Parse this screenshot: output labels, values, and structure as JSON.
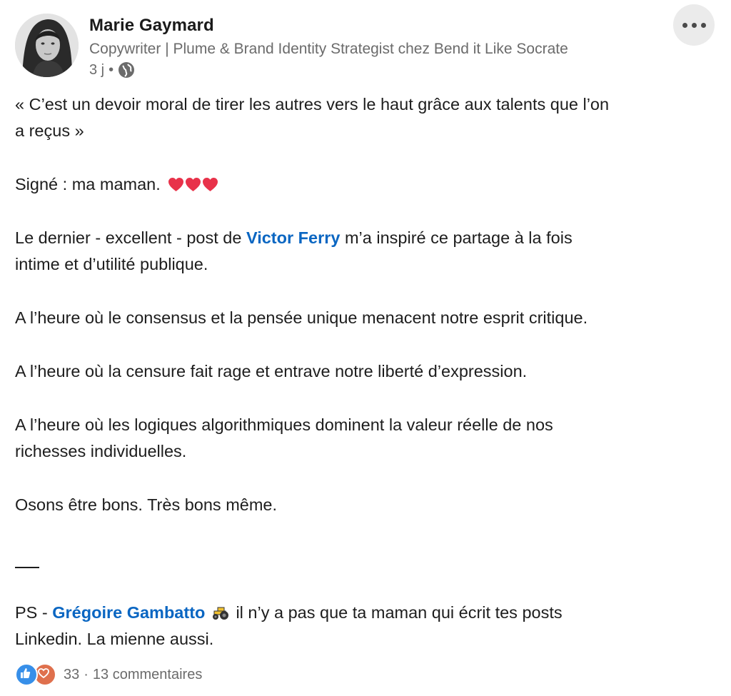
{
  "author": {
    "name": "Marie Gaymard",
    "headline": "Copywriter | Plume & Brand Identity Strategist chez Bend it Like Socrate",
    "time": "3 j",
    "bullet": "•"
  },
  "post": {
    "quote_line1": "« C’est un devoir moral de tirer les autres vers le haut grâce aux talents que l’on",
    "quote_line2": "a reçus »",
    "signed": "Signé : ma maman.",
    "inspired_before": "Le dernier - excellent - post de ",
    "inspired_mention": "Victor Ferry",
    "inspired_after": " m’a inspiré ce partage à la fois",
    "inspired_line2": "intime et d’utilité publique.",
    "line_consensus": "A l’heure où le consensus et la pensée unique menacent notre esprit critique.",
    "line_censure": "A l’heure où la censure fait rage et entrave notre liberté d’expression.",
    "line_algo1": "A l’heure où les logiques algorithmiques dominent la valeur réelle de nos",
    "line_algo2": "richesses individuelles.",
    "line_osons": "Osons être bons. Très bons même.",
    "ps_prefix": "PS - ",
    "ps_mention": "Grégoire Gambatto",
    "ps_after": " il n’y a pas que ta maman qui écrit tes posts",
    "ps_line2": "Linkedin. La mienne aussi."
  },
  "social": {
    "reaction_count": "33",
    "separator": "·",
    "comments": "13 commentaires"
  },
  "icons": {
    "more": "more-horizontal-icon",
    "globe": "globe-icon",
    "heart": "red-heart-emoji",
    "tractor": "tractor-emoji",
    "like": "like-reaction-icon",
    "love": "love-reaction-icon"
  },
  "colors": {
    "mention": "#0a66c2",
    "secondary_text": "#6b6b6b",
    "like_blue": "#378fe9",
    "love_orange": "#df704d"
  }
}
